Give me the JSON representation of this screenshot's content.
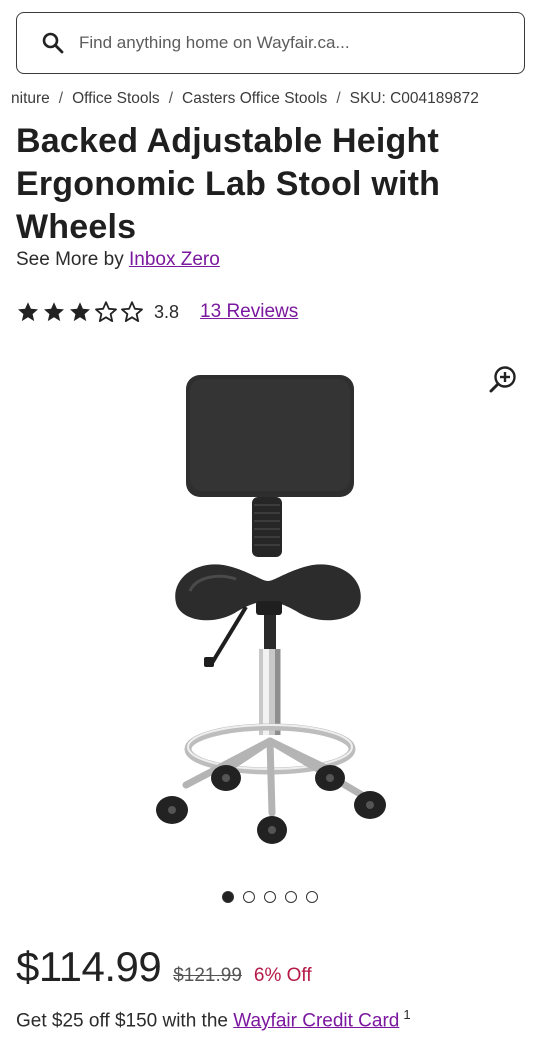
{
  "search": {
    "placeholder": "Find anything home on Wayfair.ca..."
  },
  "breadcrumb": {
    "items": [
      "niture",
      "Office Stools",
      "Casters Office Stools",
      "SKU: C004189872"
    ]
  },
  "product": {
    "title": "Backed Adjustable Height Ergonomic Lab Stool with Wheels",
    "see_more_prefix": "See More by ",
    "brand": "Inbox Zero",
    "rating": "3.8",
    "rating_fraction": 0.76,
    "reviews": "13 Reviews",
    "image_count": 5,
    "active_image": 0
  },
  "pricing": {
    "price": "$114.99",
    "old_price": "$121.99",
    "discount": "6% Off",
    "credit_prefix": "Get $25 off $150 with the ",
    "credit_link": "Wayfair Credit Card",
    "credit_footnote": "1"
  },
  "colors": {
    "accent": "#7b189f",
    "discount": "#b51a47"
  },
  "icons": {
    "search": "search-icon",
    "zoom": "zoom-in-icon",
    "star": "star-icon"
  }
}
